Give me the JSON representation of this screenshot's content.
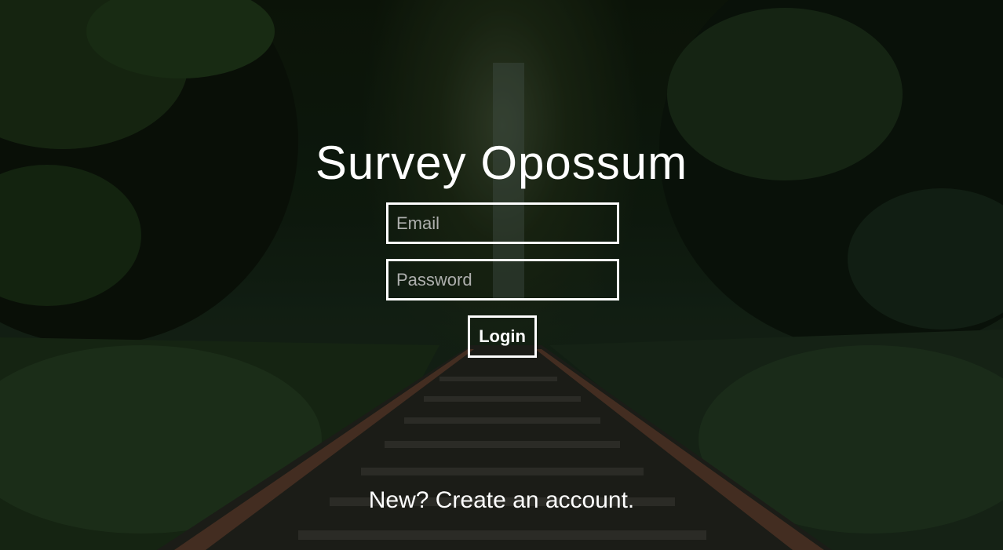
{
  "app": {
    "title": "Survey Opossum"
  },
  "login_form": {
    "email_placeholder": "Email",
    "password_placeholder": "Password",
    "login_label": "Login"
  },
  "signup_link": {
    "label": "New? Create an account."
  },
  "colors": {
    "text": "#ffffff",
    "field_border": "#ffffff",
    "background_tone": "#142214"
  }
}
